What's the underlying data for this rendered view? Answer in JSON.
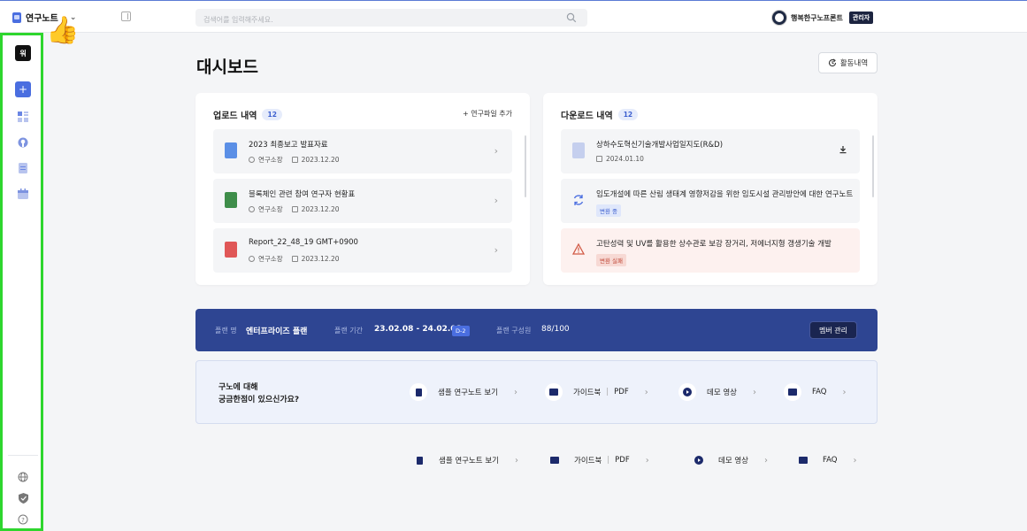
{
  "topbar": {
    "brand_name": "연구노트",
    "search_placeholder": "검색어를 입력해주세요.",
    "user_name": "행복한구노프론트",
    "role": "관리자"
  },
  "sidebar": {
    "workspace_initial": "워",
    "add": "+"
  },
  "overlay": {
    "thumb": "👍"
  },
  "page": {
    "title": "대시보드",
    "activity_button": "활동내역"
  },
  "upload": {
    "title": "업로드 내역",
    "count": "12",
    "add_label": "+ 연구파일 추가",
    "items": [
      {
        "title": "2023 최종보고 발표자료",
        "author": "연구소장",
        "date": "2023.12.20",
        "color": "#5b8fe6"
      },
      {
        "title": "블록체인 관련 참여 연구자 현황표",
        "author": "연구소장",
        "date": "2023.12.20",
        "color": "#3e8d4a"
      },
      {
        "title": "Report_22_48_19 GMT+0900",
        "author": "연구소장",
        "date": "2023.12.20",
        "color": "#e05757"
      }
    ]
  },
  "download": {
    "title": "다운로드 내역",
    "count": "12",
    "items": [
      {
        "title": "상하수도혁신기술개발사업일지도(R&D)",
        "date": "2024.01.10"
      },
      {
        "title": "임도개설에 따른 산림 생태계 영향저감을 위한 임도시설 관리방안에 대한 연구노트",
        "status": "변환 중"
      },
      {
        "title": "고탄성력 및 UV를 활용한 상수관로 보강 장거리, 저에너지형 갱생기술 개발",
        "status": "변환 실패"
      }
    ]
  },
  "plan": {
    "name_label": "플랜 명",
    "name": "엔터프라이즈 플랜",
    "period_label": "플랜 기간",
    "period": "23.02.08 - 24.02.08",
    "dday": "D-2",
    "members_label": "플랜 구성원",
    "members": "88/100",
    "member_button": "멤버 관리"
  },
  "help": {
    "question_line1": "구노에 대해",
    "question_line2": "궁금한점이 있으신가요?",
    "sample": "샘플 연구노트 보기",
    "guide": "가이드북",
    "pdf": "PDF",
    "demo": "데모 영상",
    "faq": "FAQ"
  },
  "colors": {
    "accent": "#4a6ee0",
    "plan_bg": "#2e4592",
    "sidebar_border": "#2ed62e"
  }
}
